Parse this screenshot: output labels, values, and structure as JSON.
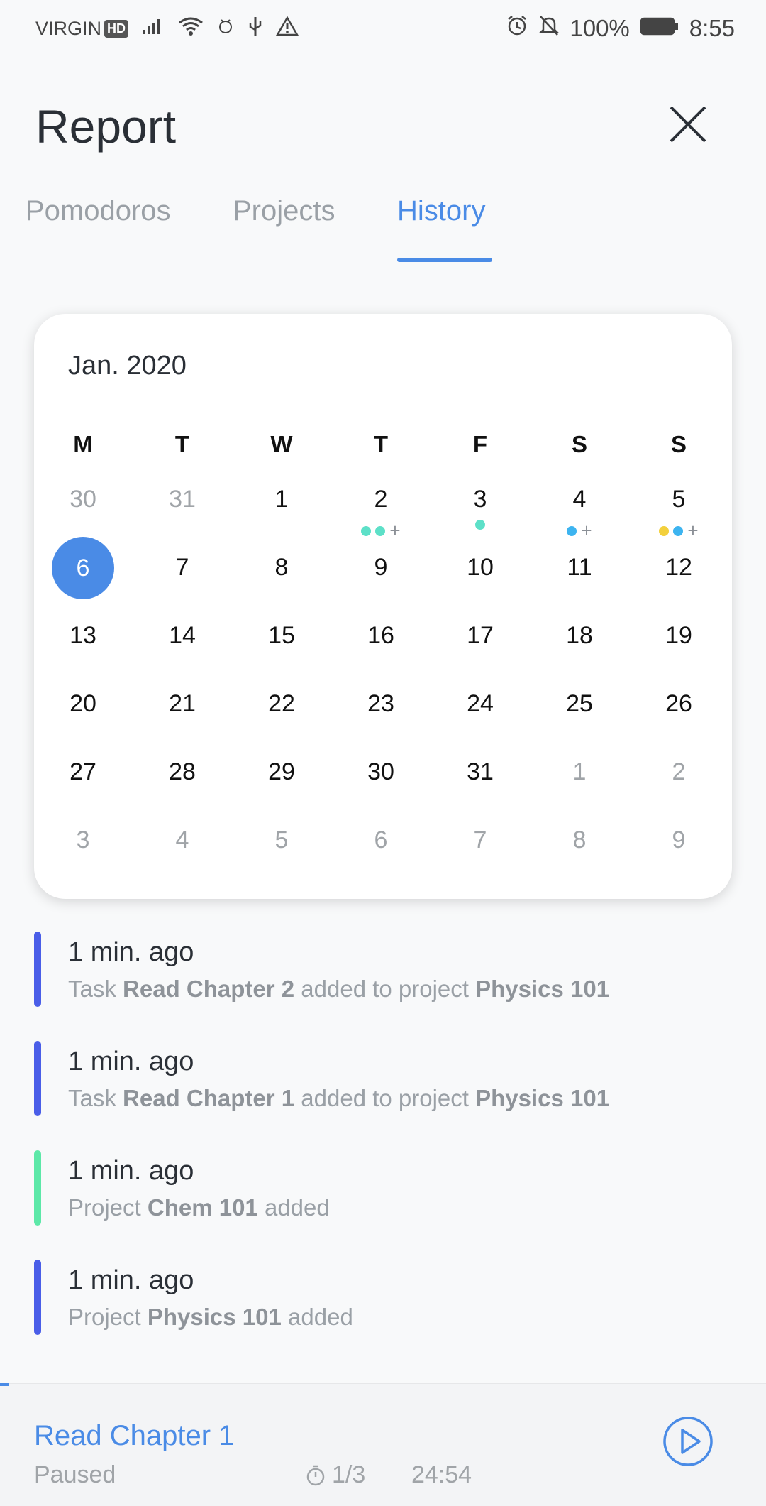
{
  "status_bar": {
    "carrier": "VIRGIN",
    "hd": "HD",
    "battery": "100%",
    "time": "8:55"
  },
  "header": {
    "title": "Report",
    "tabs": [
      "Pomodoros",
      "Projects",
      "History"
    ],
    "active_tab": "History"
  },
  "calendar": {
    "month": "Jan. 2020",
    "weekdays": [
      "M",
      "T",
      "W",
      "T",
      "F",
      "S",
      "S"
    ],
    "weeks": [
      [
        "30",
        "31",
        "1",
        "2",
        "3",
        "4",
        "5"
      ],
      [
        "6",
        "7",
        "8",
        "9",
        "10",
        "11",
        "12"
      ],
      [
        "13",
        "14",
        "15",
        "16",
        "17",
        "18",
        "19"
      ],
      [
        "20",
        "21",
        "22",
        "23",
        "24",
        "25",
        "26"
      ],
      [
        "27",
        "28",
        "29",
        "30",
        "31",
        "1",
        "2"
      ],
      [
        "3",
        "4",
        "5",
        "6",
        "7",
        "8",
        "9"
      ]
    ],
    "selected": "6",
    "markers": [
      {
        "day": "2",
        "dots": [
          "#5de0c8",
          "#5de0c8"
        ],
        "plus": "+"
      },
      {
        "day": "3",
        "dots": [
          "#5de0c8"
        ],
        "plus": ""
      },
      {
        "day": "4",
        "dots": [
          "#3db4f0"
        ],
        "plus": "+"
      },
      {
        "day": "5",
        "dots": [
          "#f3d03c",
          "#3db4f0"
        ],
        "plus": "+"
      }
    ]
  },
  "history": [
    {
      "when": "1 min. ago",
      "color": "#4a5ee8",
      "parts": [
        "Task ",
        "Read Chapter 2",
        " added to project ",
        "Physics 101"
      ]
    },
    {
      "when": "1 min. ago",
      "color": "#4a5ee8",
      "parts": [
        "Task ",
        "Read Chapter 1",
        " added to project ",
        "Physics 101"
      ]
    },
    {
      "when": "1 min. ago",
      "color": "#5de8a8",
      "parts": [
        "Project ",
        "Chem 101",
        " added",
        ""
      ]
    },
    {
      "when": "1 min. ago",
      "color": "#4a5ee8",
      "parts": [
        "Project ",
        "Physics 101",
        " added",
        ""
      ]
    }
  ],
  "player": {
    "task": "Read Chapter 1",
    "state": "Paused",
    "count": "1/3",
    "timer": "24:54"
  },
  "colors": {
    "accent": "#4a8be6",
    "muted": "#9aa0a6"
  }
}
